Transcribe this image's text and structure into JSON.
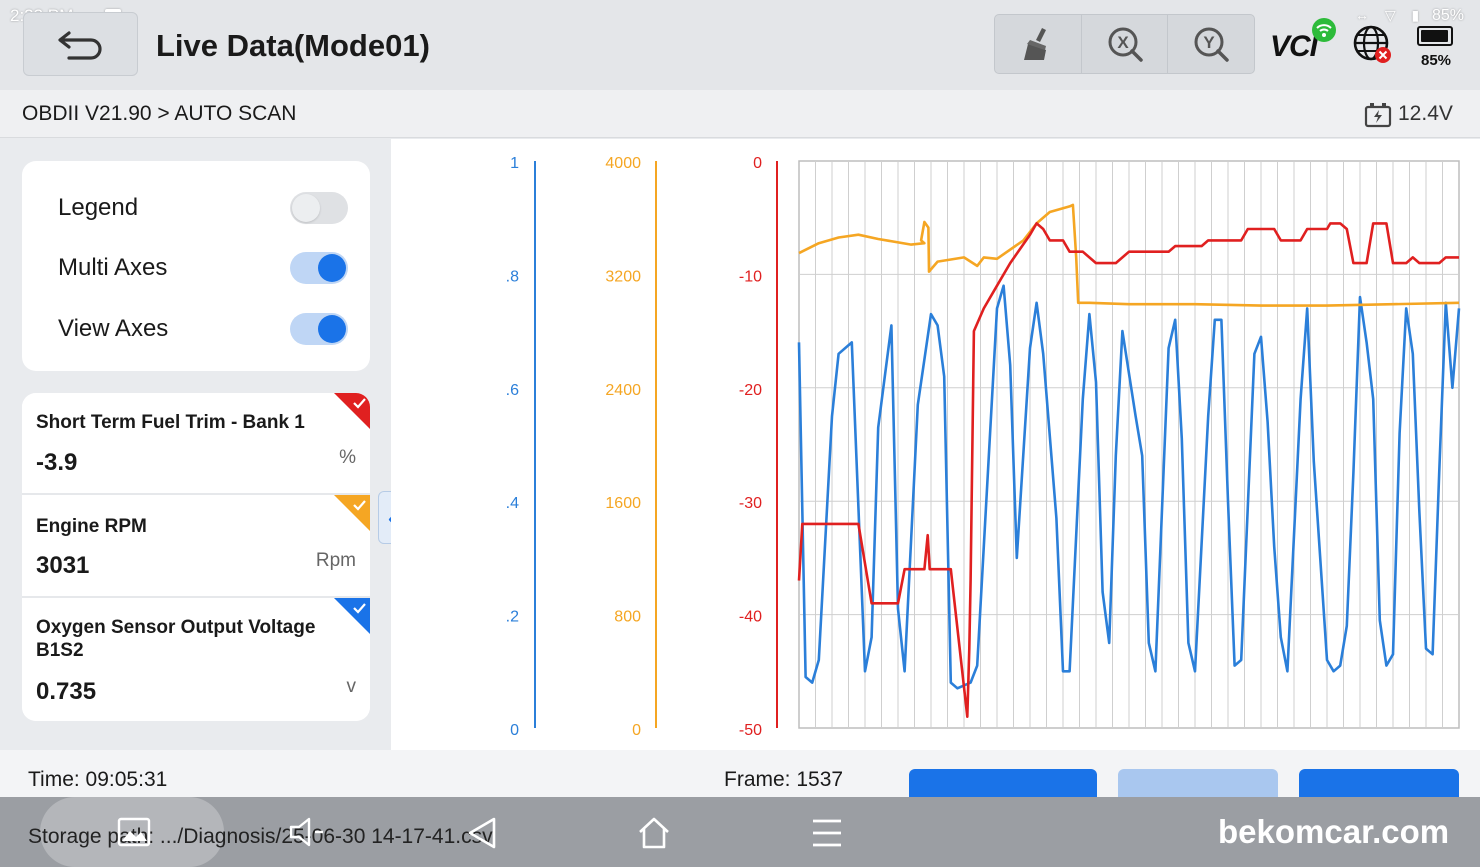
{
  "status_bar": {
    "time": "2:23 PM",
    "battery": "85%"
  },
  "header": {
    "title": "Live Data(Mode01)",
    "vci_label": "VCI",
    "battery_percent": "85%",
    "tools": [
      {
        "name": "clear-brush-icon"
      },
      {
        "name": "x-zoom-icon",
        "glyph": "X"
      },
      {
        "name": "y-zoom-icon",
        "glyph": "Y"
      }
    ]
  },
  "breadcrumb": {
    "path": "OBDII V21.90 > AUTO SCAN",
    "voltage": "12.4V"
  },
  "options": [
    {
      "label": "Legend",
      "on": false
    },
    {
      "label": "Multi Axes",
      "on": true
    },
    {
      "label": "View Axes",
      "on": true
    }
  ],
  "pids": [
    {
      "name": "Short Term Fuel Trim - Bank 1",
      "value": "-3.9",
      "unit": "%",
      "color": "#e02020"
    },
    {
      "name": "Engine RPM",
      "value": "3031",
      "unit": "Rpm",
      "color": "#f5a623"
    },
    {
      "name": "Oxygen Sensor Output Voltage B1S2",
      "value": "0.735",
      "unit": "v",
      "color": "#1a73e8"
    }
  ],
  "chart_data": {
    "type": "line",
    "grid": true,
    "legend": false,
    "axes": [
      {
        "series": "Oxygen Sensor Output Voltage B1S2",
        "color": "#2b7fd9",
        "ticks": [
          "1",
          ".8",
          ".6",
          ".4",
          ".2",
          "0"
        ],
        "ylim": [
          0,
          1
        ]
      },
      {
        "series": "Engine RPM",
        "color": "#f5a623",
        "ticks": [
          "4000",
          "3200",
          "2400",
          "1600",
          "800",
          "0"
        ],
        "ylim": [
          0,
          4000
        ]
      },
      {
        "series": "Short Term Fuel Trim - Bank 1",
        "color": "#e02020",
        "ticks": [
          "0",
          "-10",
          "-20",
          "-30",
          "-40",
          "-50"
        ],
        "ylim": [
          -50,
          0
        ]
      }
    ],
    "series": [
      {
        "name": "Oxygen Sensor Output Voltage B1S2",
        "color": "#2b7fd9",
        "x": [
          0,
          1,
          2,
          3,
          4,
          5,
          6,
          7,
          8,
          9,
          10,
          11,
          12,
          13,
          14,
          15,
          16,
          17,
          18,
          19,
          20,
          21,
          22,
          23,
          24,
          25,
          26,
          27,
          28,
          29,
          30,
          31,
          32,
          33,
          34,
          35,
          36,
          37,
          38,
          39,
          40,
          41,
          42,
          43,
          44,
          45,
          46,
          47,
          48,
          49,
          50,
          51,
          52,
          53,
          54,
          55,
          56,
          57,
          58,
          59,
          60,
          61,
          62,
          63,
          64,
          65,
          66,
          67,
          68,
          69,
          70,
          71,
          72,
          73,
          74,
          75,
          76,
          77,
          78,
          79,
          80,
          81,
          82,
          83,
          84,
          85,
          86,
          87,
          88,
          89,
          90,
          91,
          92,
          93,
          94,
          95,
          96,
          97,
          98,
          99,
          100
        ],
        "values": [
          0.68,
          0.09,
          0.08,
          0.12,
          0.35,
          0.55,
          0.66,
          0.69,
          0.68,
          0.67,
          0.1,
          0.16,
          0.53,
          0.71,
          0.63,
          0.21,
          0.1,
          0.15,
          0.57,
          0.68,
          0.73,
          0.71,
          0.62,
          0.08,
          0.07,
          0.08,
          0.08,
          0.11,
          0.33,
          0.56,
          0.74,
          0.78,
          0.64,
          0.3,
          0.27,
          0.67,
          0.75,
          0.66,
          0.53,
          0.37,
          0.1,
          0.1,
          0.25,
          0.58,
          0.73,
          0.61,
          0.24,
          0.15,
          0.48,
          0.7,
          0.67,
          0.55,
          0.48,
          0.15,
          0.1,
          0.28,
          0.67,
          0.72,
          0.51,
          0.15,
          0.1,
          0.13,
          0.55,
          0.72,
          0.72,
          0.4,
          0.11,
          0.12,
          0.35,
          0.66,
          0.69,
          0.54,
          0.32,
          0.16,
          0.1,
          0.28,
          0.58,
          0.74,
          0.47,
          0.22,
          0.12,
          0.1,
          0.11,
          0.18,
          0.45,
          0.76,
          0.68,
          0.58,
          0.19,
          0.11,
          0.13,
          0.52,
          0.74,
          0.66,
          0.38,
          0.14,
          0.13,
          0.45,
          0.75,
          0.6,
          0.15
        ],
        "points": [
          [
            0,
            0.68
          ],
          [
            1,
            0.09
          ],
          [
            2,
            0.08
          ],
          [
            3,
            0.12
          ],
          [
            5,
            0.55
          ],
          [
            6,
            0.66
          ],
          [
            8,
            0.68
          ],
          [
            10,
            0.1
          ],
          [
            11,
            0.16
          ],
          [
            12,
            0.53
          ],
          [
            14,
            0.71
          ],
          [
            15,
            0.21
          ],
          [
            16,
            0.1
          ],
          [
            18,
            0.57
          ],
          [
            20,
            0.73
          ],
          [
            21,
            0.71
          ],
          [
            22,
            0.62
          ],
          [
            23,
            0.08
          ],
          [
            24,
            0.07
          ],
          [
            26,
            0.08
          ],
          [
            27,
            0.11
          ],
          [
            30,
            0.74
          ],
          [
            31,
            0.78
          ],
          [
            32,
            0.64
          ],
          [
            33,
            0.3
          ],
          [
            35,
            0.67
          ],
          [
            36,
            0.75
          ],
          [
            37,
            0.66
          ],
          [
            39,
            0.37
          ],
          [
            40,
            0.1
          ],
          [
            41,
            0.1
          ],
          [
            43,
            0.58
          ],
          [
            44,
            0.73
          ],
          [
            45,
            0.61
          ],
          [
            46,
            0.24
          ],
          [
            47,
            0.15
          ],
          [
            48,
            0.48
          ],
          [
            49,
            0.7
          ],
          [
            51,
            0.55
          ],
          [
            52,
            0.48
          ],
          [
            53,
            0.15
          ],
          [
            54,
            0.1
          ],
          [
            56,
            0.67
          ],
          [
            57,
            0.72
          ],
          [
            58,
            0.51
          ],
          [
            59,
            0.15
          ],
          [
            60,
            0.1
          ],
          [
            62,
            0.55
          ],
          [
            63,
            0.72
          ],
          [
            64,
            0.72
          ],
          [
            65,
            0.4
          ],
          [
            66,
            0.11
          ],
          [
            67,
            0.12
          ],
          [
            69,
            0.66
          ],
          [
            70,
            0.69
          ],
          [
            71,
            0.54
          ],
          [
            72,
            0.32
          ],
          [
            73,
            0.16
          ],
          [
            74,
            0.1
          ],
          [
            76,
            0.58
          ],
          [
            77,
            0.74
          ],
          [
            78,
            0.47
          ],
          [
            80,
            0.12
          ],
          [
            81,
            0.1
          ],
          [
            82,
            0.11
          ],
          [
            83,
            0.18
          ],
          [
            84,
            0.45
          ],
          [
            85,
            0.76
          ],
          [
            86,
            0.68
          ],
          [
            87,
            0.58
          ],
          [
            88,
            0.19
          ],
          [
            89,
            0.11
          ],
          [
            90,
            0.13
          ],
          [
            91,
            0.52
          ],
          [
            92,
            0.74
          ],
          [
            93,
            0.66
          ],
          [
            94,
            0.38
          ],
          [
            95,
            0.14
          ],
          [
            96,
            0.13
          ],
          [
            97,
            0.45
          ],
          [
            98,
            0.75
          ],
          [
            99,
            0.6
          ],
          [
            100,
            0.74
          ]
        ]
      },
      {
        "name": "Engine RPM",
        "color": "#f5a623",
        "points": [
          [
            0,
            3350
          ],
          [
            3,
            3420
          ],
          [
            6,
            3460
          ],
          [
            9,
            3480
          ],
          [
            12,
            3450
          ],
          [
            17,
            3410
          ],
          [
            19,
            3420
          ],
          [
            18.5,
            3440
          ],
          [
            19,
            3570
          ],
          [
            19.6,
            3530
          ],
          [
            19.7,
            3220
          ],
          [
            21,
            3290
          ],
          [
            25,
            3320
          ],
          [
            27,
            3260
          ],
          [
            28,
            3320
          ],
          [
            30,
            3310
          ],
          [
            34,
            3440
          ],
          [
            36,
            3560
          ],
          [
            38,
            3640
          ],
          [
            41,
            3680
          ],
          [
            41.5,
            3690
          ],
          [
            42,
            3320
          ],
          [
            42.3,
            3000
          ],
          [
            44,
            3000
          ],
          [
            50,
            2990
          ],
          [
            60,
            2990
          ],
          [
            70,
            2980
          ],
          [
            80,
            2980
          ],
          [
            90,
            2990
          ],
          [
            100,
            3000
          ]
        ]
      },
      {
        "name": "Short Term Fuel Trim - Bank 1",
        "color": "#e02020",
        "points": [
          [
            0,
            -37
          ],
          [
            0.5,
            -32
          ],
          [
            4,
            -32
          ],
          [
            6,
            -32
          ],
          [
            9,
            -32
          ],
          [
            11,
            -39
          ],
          [
            15,
            -39
          ],
          [
            16,
            -36
          ],
          [
            19,
            -36
          ],
          [
            19.5,
            -33
          ],
          [
            19.8,
            -36
          ],
          [
            23,
            -36
          ],
          [
            25.5,
            -49
          ],
          [
            25.8,
            -43
          ],
          [
            26,
            -37
          ],
          [
            26.5,
            -15
          ],
          [
            28,
            -13
          ],
          [
            30,
            -11
          ],
          [
            32,
            -9
          ],
          [
            35,
            -6.5
          ],
          [
            36,
            -5.5
          ],
          [
            37,
            -6
          ],
          [
            38,
            -7
          ],
          [
            40,
            -7
          ],
          [
            41,
            -8
          ],
          [
            43,
            -8
          ],
          [
            45,
            -9
          ],
          [
            48,
            -9
          ],
          [
            50,
            -8
          ],
          [
            56,
            -8
          ],
          [
            57,
            -7.5
          ],
          [
            61,
            -7.5
          ],
          [
            62,
            -7
          ],
          [
            67,
            -7
          ],
          [
            68,
            -6
          ],
          [
            72,
            -6
          ],
          [
            73,
            -7
          ],
          [
            76,
            -7
          ],
          [
            77,
            -6
          ],
          [
            80,
            -6
          ],
          [
            80.5,
            -5.5
          ],
          [
            82,
            -5.5
          ],
          [
            83,
            -6
          ],
          [
            84,
            -9
          ],
          [
            86,
            -9
          ],
          [
            87,
            -5.5
          ],
          [
            89,
            -5.5
          ],
          [
            90,
            -9
          ],
          [
            92,
            -9
          ],
          [
            93,
            -8.5
          ],
          [
            94,
            -9
          ],
          [
            97,
            -9
          ],
          [
            98,
            -8.5
          ],
          [
            100,
            -8.5
          ]
        ]
      }
    ]
  },
  "footer": {
    "time": "Time: 09:05:31",
    "frame": "Frame: 1537",
    "storage": "Storage path:   .../Diagnosis/25-06-30 14-17-41.csv",
    "watermark": "bekomcar.com"
  }
}
